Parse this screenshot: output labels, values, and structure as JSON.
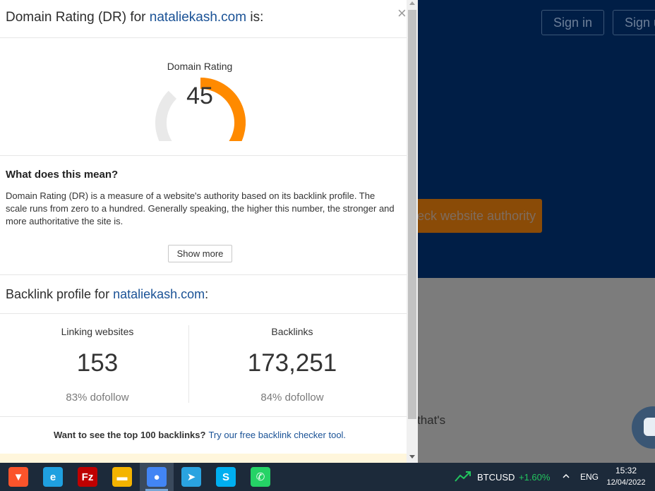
{
  "background_page": {
    "sign_in_label": "Sign in",
    "sign_up_label": "Sign up",
    "cta_label": "Check website authority",
    "text_line_1": ")",
    "text_line_2": "that's"
  },
  "modal": {
    "title_prefix": "Domain Rating (DR) for ",
    "domain": "nataliekash.com",
    "title_suffix": " is:",
    "close_symbol": "×",
    "dr": {
      "label": "Domain Rating",
      "value": 45,
      "max": 100,
      "gauge_fill_color": "#ff8a00",
      "gauge_track_color": "#e9e9e9"
    },
    "meaning": {
      "title": "What does this mean?",
      "text": "Domain Rating (DR) is a measure of a website's authority based on its backlink profile. The scale runs from zero to a hundred. Generally speaking, the higher this number, the stronger and more authoritative the site is.",
      "show_more_label": "Show more"
    },
    "backlink_profile": {
      "title_prefix": "Backlink profile for ",
      "domain": "nataliekash.com",
      "title_suffix": ":",
      "stats": [
        {
          "label": "Linking websites",
          "value": "153",
          "sub": "83% dofollow"
        },
        {
          "label": "Backlinks",
          "value": "173,251",
          "sub": "84% dofollow"
        }
      ]
    },
    "footer": {
      "question": "Want to see the top 100 backlinks?",
      "link_label": "Try our free backlink checker tool."
    }
  },
  "taskbar": {
    "apps": [
      {
        "name": "brave",
        "glyph": "▼",
        "color": "#fb542b"
      },
      {
        "name": "edge",
        "glyph": "e",
        "color": "#1fa0e0"
      },
      {
        "name": "filezilla",
        "glyph": "Fz",
        "color": "#bf0000"
      },
      {
        "name": "file-explorer",
        "glyph": "▬",
        "color": "#f4b400"
      },
      {
        "name": "chrome",
        "glyph": "●",
        "color": "#4285f4"
      },
      {
        "name": "telegram",
        "glyph": "➤",
        "color": "#2aa3e0"
      },
      {
        "name": "skype",
        "glyph": "S",
        "color": "#00aff0"
      },
      {
        "name": "whatsapp",
        "glyph": "✆",
        "color": "#25d366"
      }
    ],
    "ticker": "BTCUSD",
    "ticker_change": "+1.60%",
    "language": "ENG",
    "time": "15:32",
    "date": "12/04/2022"
  }
}
